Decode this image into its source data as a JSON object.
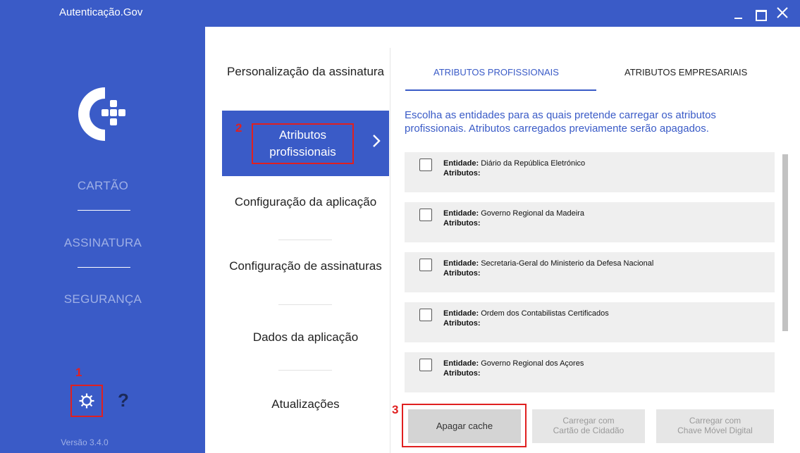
{
  "window": {
    "title": "Autenticação.Gov"
  },
  "sidebar": {
    "items": [
      {
        "label": "CARTÃO"
      },
      {
        "label": "ASSINATURA"
      },
      {
        "label": "SEGURANÇA"
      }
    ],
    "help_label": "?",
    "version": "Versão 3.4.0"
  },
  "annotations": {
    "one": "1",
    "two": "2",
    "three": "3"
  },
  "settings_menu": {
    "items": [
      {
        "label": "Personalização da assinatura"
      },
      {
        "label": "Atributos profissionais"
      },
      {
        "label": "Configuração da aplicação"
      },
      {
        "label": "Configuração de assinaturas"
      },
      {
        "label": "Dados da aplicação"
      },
      {
        "label": "Atualizações"
      }
    ]
  },
  "tabs": [
    {
      "label": "ATRIBUTOS PROFISSIONAIS"
    },
    {
      "label": "ATRIBUTOS EMPRESARIAIS"
    }
  ],
  "description": "Escolha as entidades para as quais pretende carregar os atributos profissionais. Atributos carregados previamente serão apagados.",
  "entity_prefix": "Entidade:",
  "attributes_label": "Atributos:",
  "entities": [
    {
      "name": "Diário da República Eletrónico"
    },
    {
      "name": "Governo Regional da Madeira"
    },
    {
      "name": "Secretaria-Geral do Ministerio da Defesa Nacional"
    },
    {
      "name": "Ordem dos Contabilistas Certificados"
    },
    {
      "name": "Governo Regional dos Açores"
    }
  ],
  "buttons": {
    "clear_cache": "Apagar cache",
    "load_cc_line1": "Carregar com",
    "load_cc_line2": "Cartão de Cidadão",
    "load_cmd_line1": "Carregar com",
    "load_cmd_line2": "Chave Móvel Digital"
  },
  "colors": {
    "accent": "#3a5bc7",
    "annotation": "#e02020",
    "card_bg": "#efefef"
  }
}
